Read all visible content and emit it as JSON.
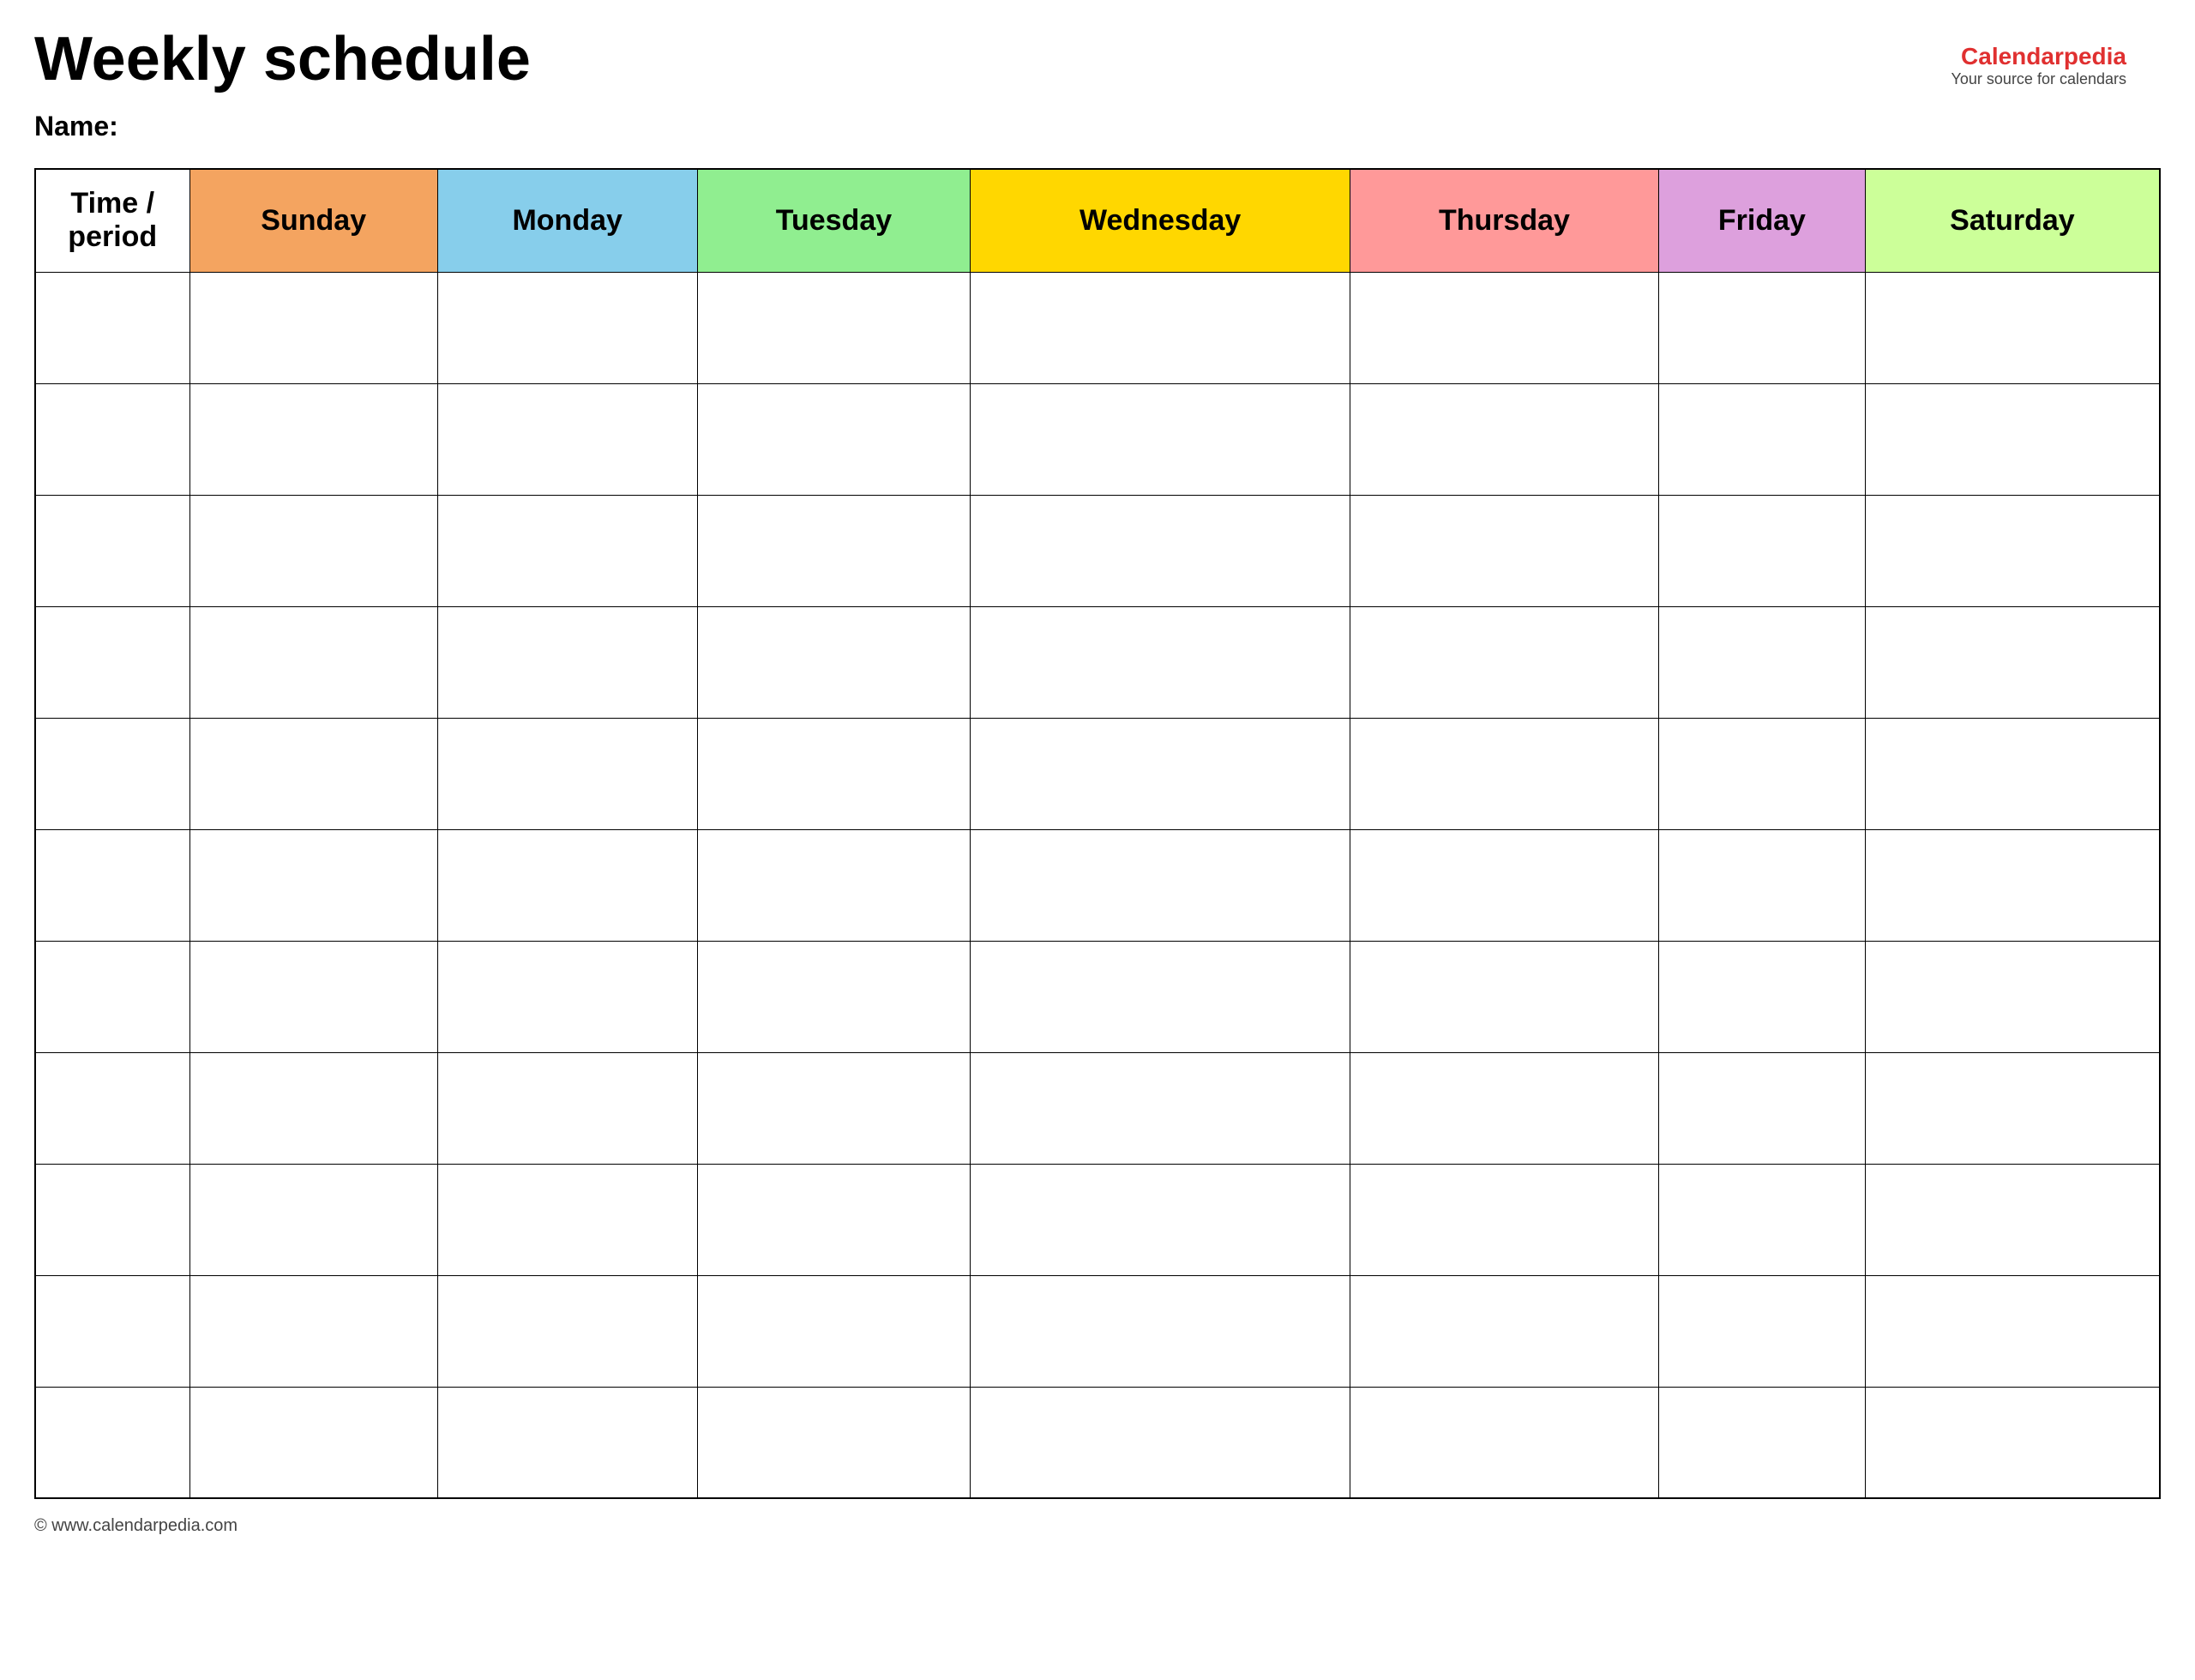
{
  "page": {
    "title": "Weekly schedule",
    "name_label": "Name:",
    "footer_text": "© www.calendarpedia.com"
  },
  "logo": {
    "text_part1": "Calendar",
    "text_part2": "pedia",
    "subtitle": "Your source for calendars"
  },
  "table": {
    "headers": [
      {
        "id": "time-period",
        "label": "Time / period",
        "class": "time-period-header"
      },
      {
        "id": "sunday",
        "label": "Sunday",
        "class": "sunday-header"
      },
      {
        "id": "monday",
        "label": "Monday",
        "class": "monday-header"
      },
      {
        "id": "tuesday",
        "label": "Tuesday",
        "class": "tuesday-header"
      },
      {
        "id": "wednesday",
        "label": "Wednesday",
        "class": "wednesday-header"
      },
      {
        "id": "thursday",
        "label": "Thursday",
        "class": "thursday-header"
      },
      {
        "id": "friday",
        "label": "Friday",
        "class": "friday-header"
      },
      {
        "id": "saturday",
        "label": "Saturday",
        "class": "saturday-header"
      }
    ],
    "row_count": 11
  }
}
